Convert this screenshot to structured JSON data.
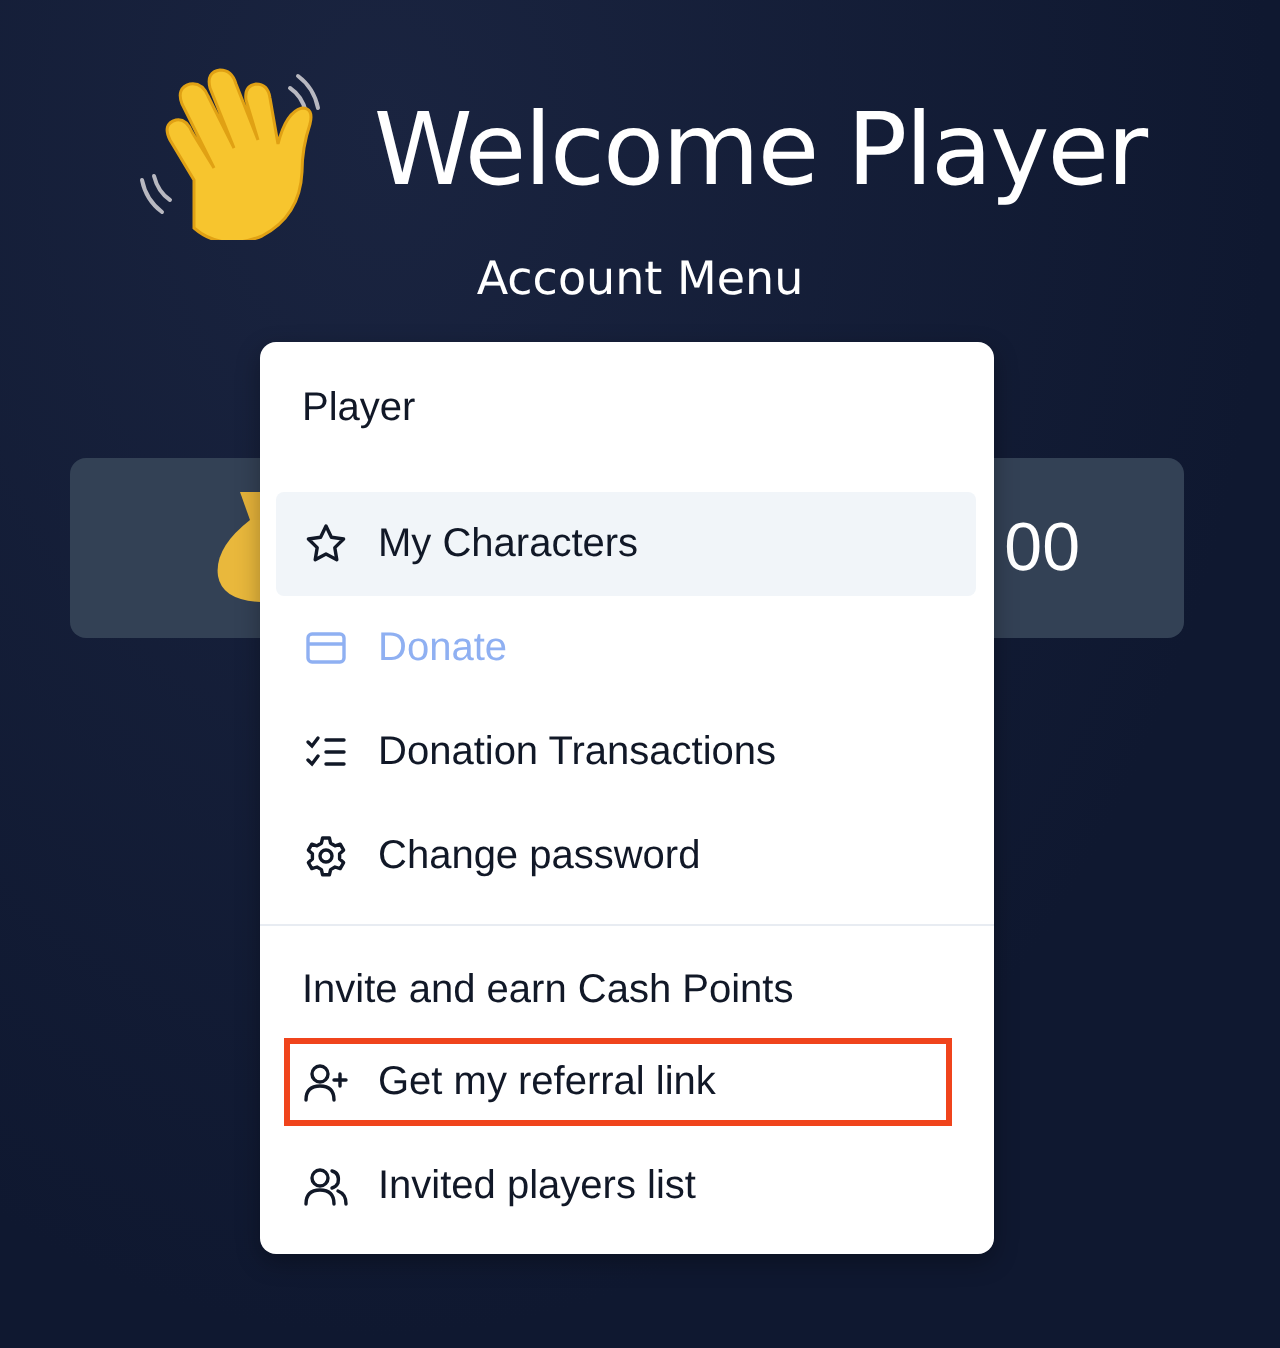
{
  "header": {
    "title": "Welcome Player",
    "subtitle": "Account Menu"
  },
  "balance_card": {
    "value": "00"
  },
  "menu": {
    "sections": [
      {
        "label": "Player",
        "items": [
          {
            "label": "My Characters",
            "selected": true,
            "disabled": false,
            "highlighted": false
          },
          {
            "label": "Donate",
            "selected": false,
            "disabled": true,
            "highlighted": false
          },
          {
            "label": "Donation Transactions",
            "selected": false,
            "disabled": false,
            "highlighted": false
          },
          {
            "label": "Change password",
            "selected": false,
            "disabled": false,
            "highlighted": false
          }
        ]
      },
      {
        "label": "Invite and earn Cash Points",
        "items": [
          {
            "label": "Get my referral link",
            "selected": false,
            "disabled": false,
            "highlighted": true
          },
          {
            "label": "Invited players list",
            "selected": false,
            "disabled": false,
            "highlighted": false
          }
        ]
      }
    ]
  }
}
